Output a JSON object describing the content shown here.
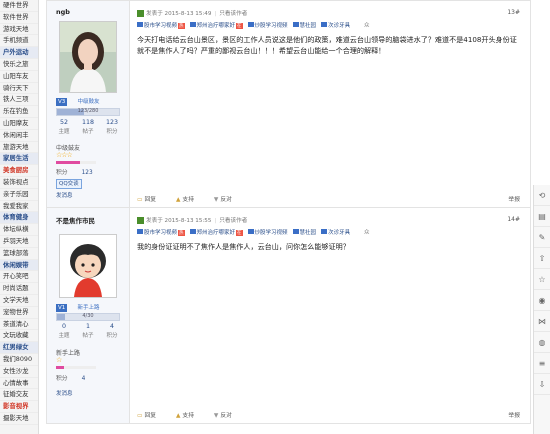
{
  "sidebar": {
    "rows": [
      {
        "label": "硬件世界",
        "type": "item"
      },
      {
        "label": "软件世界",
        "type": "item"
      },
      {
        "label": "游戏天地",
        "type": "item"
      },
      {
        "label": "手机频道",
        "type": "item"
      },
      {
        "label": "户外运动",
        "type": "section"
      },
      {
        "label": "快乐之旅",
        "type": "item"
      },
      {
        "label": "山阳车友",
        "type": "item"
      },
      {
        "label": "骑行天下",
        "type": "item"
      },
      {
        "label": "铁人三项",
        "type": "item"
      },
      {
        "label": "乐在钓鱼",
        "type": "item"
      },
      {
        "label": "山阳摩友",
        "type": "item"
      },
      {
        "label": "休闲闲丰",
        "type": "item"
      },
      {
        "label": "旅游天地",
        "type": "item"
      },
      {
        "label": "家居生活",
        "type": "section"
      },
      {
        "label": "美食厨房",
        "type": "red"
      },
      {
        "label": "装饰视点",
        "type": "item"
      },
      {
        "label": "亲子乐园",
        "type": "item"
      },
      {
        "label": "我爱我家",
        "type": "item"
      },
      {
        "label": "体育健身",
        "type": "section"
      },
      {
        "label": "体坛纵横",
        "type": "item"
      },
      {
        "label": "乒羽天地",
        "type": "item"
      },
      {
        "label": "篮球部落",
        "type": "item"
      },
      {
        "label": "休闲娱带",
        "type": "section"
      },
      {
        "label": "开心笑吧",
        "type": "item"
      },
      {
        "label": "时尚话题",
        "type": "item"
      },
      {
        "label": "文学天地",
        "type": "item"
      },
      {
        "label": "宠物世界",
        "type": "item"
      },
      {
        "label": "茶道清心",
        "type": "item"
      },
      {
        "label": "文玩收藏",
        "type": "item"
      },
      {
        "label": "红男绿女",
        "type": "section"
      },
      {
        "label": "我们8090",
        "type": "item"
      },
      {
        "label": "女性沙龙",
        "type": "item"
      },
      {
        "label": "心情故事",
        "type": "item"
      },
      {
        "label": "征婚交友",
        "type": "item"
      },
      {
        "label": "影音视界",
        "type": "red"
      },
      {
        "label": "摄影天地",
        "type": "item"
      }
    ]
  },
  "posts": [
    {
      "author": {
        "name": "ngb",
        "level_badge": "V3",
        "level_name": "中级鼓友",
        "progress_text": "123/280",
        "progress_fraction": 0.44,
        "stats": [
          {
            "value": "52",
            "label": "主题"
          },
          {
            "value": "118",
            "label": "帖子"
          },
          {
            "value": "123",
            "label": "积分"
          }
        ],
        "medal": "中级鼓友",
        "stars": "☆☆☆",
        "points_label": "积分",
        "points_value": "123",
        "qq": "QQ交谈",
        "message": "发消息"
      },
      "meta": {
        "posted": "发表于 2015-8-13 15:49",
        "only_author": "只看该作者",
        "floor": "13#"
      },
      "tags": [
        "股市学习视频",
        "郑州治疗哪家好",
        "炒股学习视频",
        "慧社园",
        "次诊牙具"
      ],
      "tag_badges": [
        "热",
        "在",
        "",
        "",
        ""
      ],
      "tags_right": "众",
      "body": "今天打电话给云台山景区，景区的工作人员说这是他们的政策，难道云台山领导的脑袋进水了？难道不是4108开头身份证就不是焦作人了吗？严重的鄙视云台山！！！希望云台山能给一个合理的解释！",
      "actions": [
        "回复",
        "支持",
        "反对"
      ],
      "report": "举报"
    },
    {
      "author": {
        "name": "不是焦作市民",
        "level_badge": "V1",
        "level_name": "新手上路",
        "progress_text": "4/30",
        "progress_fraction": 0.13,
        "stats": [
          {
            "value": "0",
            "label": "主题"
          },
          {
            "value": "1",
            "label": "帖子"
          },
          {
            "value": "4",
            "label": "积分"
          }
        ],
        "medal": "新手上路",
        "stars": "☆",
        "points_label": "积分",
        "points_value": "4",
        "message": "发消息"
      },
      "meta": {
        "posted": "发表于 2015-8-13 15:55",
        "only_author": "只看该作者",
        "floor": "14#"
      },
      "tags": [
        "股市学习视频",
        "郑州治疗哪家好",
        "炒股学习视频",
        "慧社园",
        "次诊牙具"
      ],
      "tag_badges": [
        "热",
        "在",
        "",
        "",
        ""
      ],
      "tags_right": "众",
      "body": "我的身份证证明不了焦作人是焦作人，云台山，问你怎么能够证明？",
      "actions": [
        "回复",
        "支持",
        "反对"
      ],
      "report": "举报"
    }
  ],
  "right_rail": {
    "icons": [
      "back-arrow-icon",
      "page-icon",
      "edit-icon",
      "up-icon",
      "star-icon",
      "share-weibo-icon",
      "share-icon",
      "wechat-icon",
      "list-icon",
      "down-icon"
    ]
  }
}
